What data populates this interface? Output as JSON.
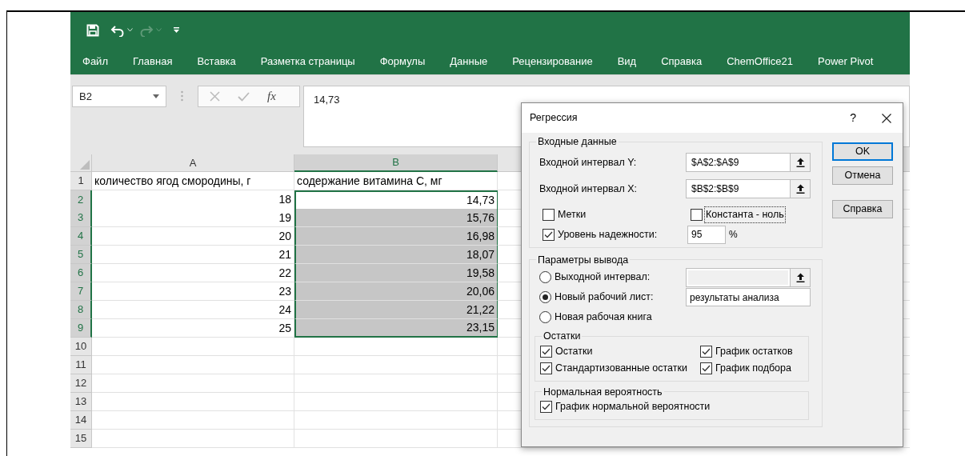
{
  "ribbon": {
    "quick_access": [
      {
        "kind": "save",
        "disabled": false
      },
      {
        "kind": "undo",
        "disabled": false
      },
      {
        "kind": "redo",
        "disabled": true
      },
      {
        "kind": "customize",
        "disabled": false
      }
    ],
    "tabs": [
      "Файл",
      "Главная",
      "Вставка",
      "Разметка страницы",
      "Формулы",
      "Данные",
      "Рецензирование",
      "Вид",
      "Справка",
      "ChemOffice21",
      "Power Pivot"
    ]
  },
  "formula_bar": {
    "name_box": "B2",
    "function_label": "fx",
    "formula": "14,73"
  },
  "sheet": {
    "columns": [
      {
        "label": "A",
        "selected": false
      },
      {
        "label": "B",
        "selected": true
      }
    ],
    "rows": [
      {
        "number": "1",
        "selected": false,
        "cells": [
          {
            "text": "количество ягод смородины, г",
            "kind": "text",
            "selected": false,
            "active": false
          },
          {
            "text": "содержание витамина С, мг",
            "kind": "text",
            "selected": false,
            "active": false
          }
        ]
      },
      {
        "number": "2",
        "selected": true,
        "cells": [
          {
            "text": "18",
            "kind": "number",
            "selected": false,
            "active": false
          },
          {
            "text": "14,73",
            "kind": "number",
            "selected": true,
            "active": true
          }
        ]
      },
      {
        "number": "3",
        "selected": true,
        "cells": [
          {
            "text": "19",
            "kind": "number",
            "selected": false,
            "active": false
          },
          {
            "text": "15,76",
            "kind": "number",
            "selected": true,
            "active": false
          }
        ]
      },
      {
        "number": "4",
        "selected": true,
        "cells": [
          {
            "text": "20",
            "kind": "number",
            "selected": false,
            "active": false
          },
          {
            "text": "16,98",
            "kind": "number",
            "selected": true,
            "active": false
          }
        ]
      },
      {
        "number": "5",
        "selected": true,
        "cells": [
          {
            "text": "21",
            "kind": "number",
            "selected": false,
            "active": false
          },
          {
            "text": "18,07",
            "kind": "number",
            "selected": true,
            "active": false
          }
        ]
      },
      {
        "number": "6",
        "selected": true,
        "cells": [
          {
            "text": "22",
            "kind": "number",
            "selected": false,
            "active": false
          },
          {
            "text": "19,58",
            "kind": "number",
            "selected": true,
            "active": false
          }
        ]
      },
      {
        "number": "7",
        "selected": true,
        "cells": [
          {
            "text": "23",
            "kind": "number",
            "selected": false,
            "active": false
          },
          {
            "text": "20,06",
            "kind": "number",
            "selected": true,
            "active": false
          }
        ]
      },
      {
        "number": "8",
        "selected": true,
        "cells": [
          {
            "text": "24",
            "kind": "number",
            "selected": false,
            "active": false
          },
          {
            "text": "21,22",
            "kind": "number",
            "selected": true,
            "active": false
          }
        ]
      },
      {
        "number": "9",
        "selected": true,
        "cells": [
          {
            "text": "25",
            "kind": "number",
            "selected": false,
            "active": false
          },
          {
            "text": "23,15",
            "kind": "number",
            "selected": true,
            "active": false
          }
        ]
      },
      {
        "number": "10",
        "selected": false
      },
      {
        "number": "11",
        "selected": false
      },
      {
        "number": "12",
        "selected": false
      },
      {
        "number": "13",
        "selected": false
      },
      {
        "number": "14",
        "selected": false
      },
      {
        "number": "15",
        "selected": false
      }
    ]
  },
  "dialog": {
    "title": "Регрессия",
    "help": "?",
    "input_group": {
      "title": "Входные данные",
      "fields": [
        {
          "label": "Входной интервал Y:",
          "value": "$A$2:$A$9"
        },
        {
          "label": "Входной интервал X:",
          "value": "$B$2:$B$9"
        }
      ],
      "options": [
        {
          "label": "Метки",
          "checked": false,
          "focused": false
        },
        {
          "label": "Константа - ноль",
          "checked": false,
          "focused": true
        }
      ],
      "confidence": {
        "label": "Уровень надежности:",
        "checked": true,
        "value": "95",
        "unit": "%"
      }
    },
    "output_group": {
      "title": "Параметры вывода",
      "choices": [
        {
          "label": "Выходной интервал:",
          "selected": false,
          "field": {
            "disabled": true
          }
        },
        {
          "label": "Новый рабочий лист:",
          "selected": true,
          "field": {
            "value": "результаты анализа",
            "disabled": false
          }
        },
        {
          "label": "Новая рабочая книга",
          "selected": false
        }
      ],
      "residuals": {
        "title": "Остатки",
        "items": [
          {
            "label": "Остатки",
            "checked": true
          },
          {
            "label": "График остатков",
            "checked": true
          },
          {
            "label": "Стандартизованные остатки",
            "checked": true
          },
          {
            "label": "График подбора",
            "checked": true
          }
        ]
      },
      "normal": {
        "title": "Нормальная вероятность",
        "items": [
          {
            "label": "График нормальной вероятности",
            "checked": true
          }
        ]
      }
    },
    "buttons": [
      {
        "label": "OK",
        "default": true
      },
      {
        "label": "Отмена",
        "default": false
      },
      {
        "label": "Справка",
        "default": false
      }
    ]
  }
}
